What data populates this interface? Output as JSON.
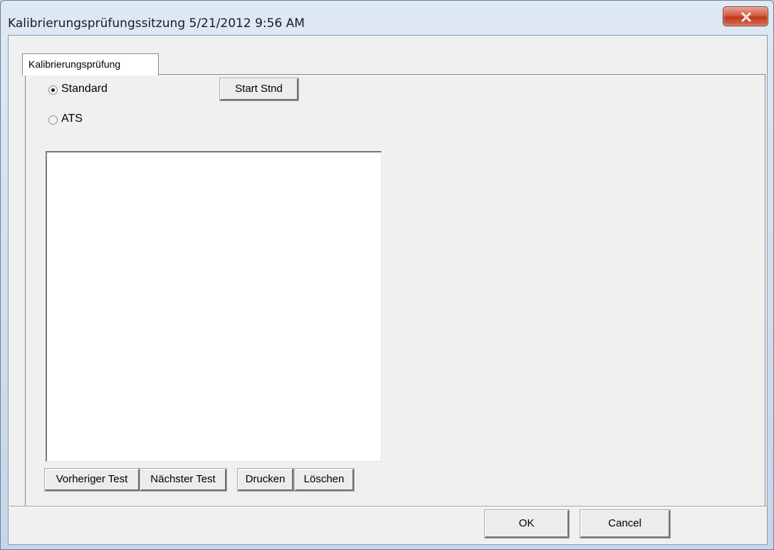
{
  "window": {
    "title": "Kalibrierungsprüfungssitzung 5/21/2012 9:56 AM",
    "close_icon": "close-icon"
  },
  "tabs": [
    {
      "label": "Kalibrierungsprüfung",
      "active": true
    }
  ],
  "mode": {
    "options": [
      {
        "label": "Standard",
        "selected": true
      },
      {
        "label": "ATS",
        "selected": false
      }
    ],
    "start_label": "Start Stnd"
  },
  "results_list": {
    "items": []
  },
  "navigation": {
    "previous_label": "Vorheriger Test",
    "next_label": "Nächster Test",
    "print_label": "Drucken",
    "delete_label": "Löschen"
  },
  "dialog_buttons": {
    "ok_label": "OK",
    "cancel_label": "Cancel"
  },
  "colors": {
    "close_button": "#c0371d",
    "dialog_face": "#f0f0f0"
  }
}
